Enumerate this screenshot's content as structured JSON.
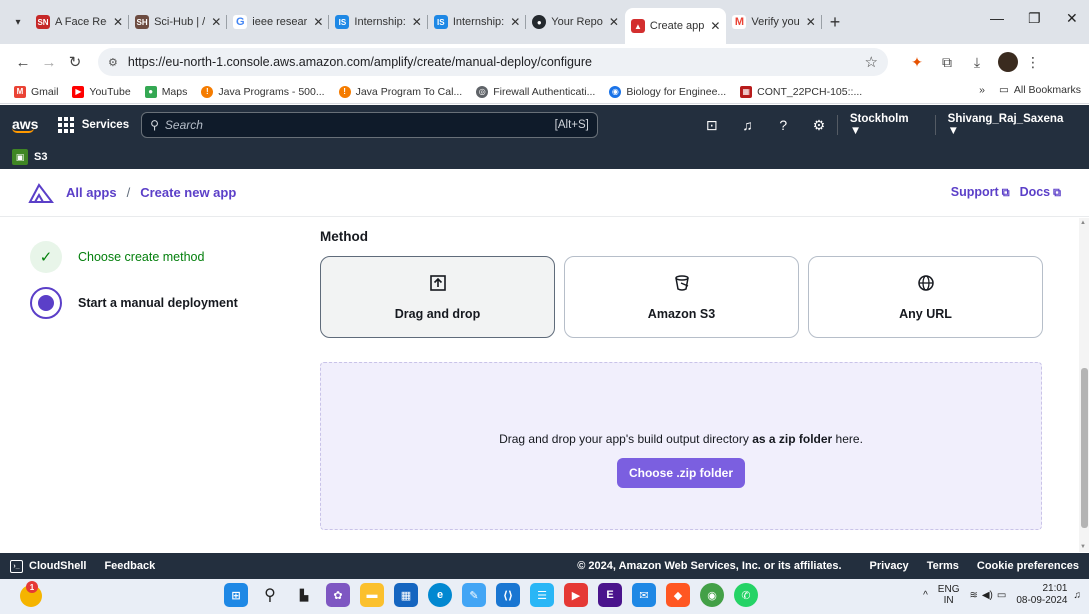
{
  "browser": {
    "tabs": [
      {
        "icon": "sn-icon",
        "color": "#c62828",
        "title": "A Face Rec"
      },
      {
        "icon": "scihub-icon",
        "color": "#6d4c41",
        "title": "Sci-Hub | /"
      },
      {
        "icon": "google-icon",
        "color": "#4285f4",
        "title": "ieee resear"
      },
      {
        "icon": "internshala-icon",
        "color": "#1e88e5",
        "title": "Internship:"
      },
      {
        "icon": "internshala-icon",
        "color": "#1e88e5",
        "title": "Internship:"
      },
      {
        "icon": "github-icon",
        "color": "#24292e",
        "title": "Your Repo"
      },
      {
        "icon": "amplify-icon",
        "color": "#d32f2f",
        "title": "Create app",
        "active": true
      },
      {
        "icon": "gmail-icon",
        "color": "#ea4335",
        "title": "Verify you"
      }
    ],
    "url": "https://eu-north-1.console.aws.amazon.com/amplify/create/manual-deploy/configure",
    "bookmarks": [
      {
        "icon": "gmail-icon",
        "color": "#ea4335",
        "label": "Gmail"
      },
      {
        "icon": "youtube-icon",
        "color": "#ff0000",
        "label": "YouTube"
      },
      {
        "icon": "maps-icon",
        "color": "#34a853",
        "label": "Maps"
      },
      {
        "icon": "java-icon",
        "color": "#f57c00",
        "label": "Java Programs - 500..."
      },
      {
        "icon": "java-icon",
        "color": "#f57c00",
        "label": "Java Program To Cal..."
      },
      {
        "icon": "firewall-icon",
        "color": "#5f6368",
        "label": "Firewall Authenticati..."
      },
      {
        "icon": "biology-icon",
        "color": "#1a73e8",
        "label": "Biology for Enginee..."
      },
      {
        "icon": "cont-icon",
        "color": "#b71c1c",
        "label": "CONT_22PCH-105::..."
      }
    ],
    "all_bookmarks": "All Bookmarks"
  },
  "aws": {
    "services_label": "Services",
    "search_placeholder": "Search",
    "search_shortcut": "[Alt+S]",
    "region": "Stockholm ▼",
    "account": "Shivang_Raj_Saxena ▼",
    "pinned_service": "S3"
  },
  "amplify": {
    "breadcrumb_root": "All apps",
    "breadcrumb_sep": "/",
    "breadcrumb_current": "Create new app",
    "support": "Support",
    "docs": "Docs",
    "steps": [
      {
        "label": "Choose create method",
        "state": "done"
      },
      {
        "label": "Start a manual deployment",
        "state": "current"
      }
    ],
    "method_title": "Method",
    "methods": [
      {
        "label": "Drag and drop",
        "icon": "upload-icon",
        "selected": true
      },
      {
        "label": "Amazon S3",
        "icon": "bucket-icon",
        "selected": false
      },
      {
        "label": "Any URL",
        "icon": "globe-icon",
        "selected": false
      }
    ],
    "dropzone_text_pre": "Drag and drop your app's build output directory ",
    "dropzone_text_bold": "as a zip folder",
    "dropzone_text_post": " here.",
    "choose_button": "Choose .zip folder"
  },
  "footer": {
    "cloudshell": "CloudShell",
    "feedback": "Feedback",
    "copyright": "© 2024, Amazon Web Services, Inc. or its affiliates.",
    "privacy": "Privacy",
    "terms": "Terms",
    "cookies": "Cookie preferences"
  },
  "taskbar": {
    "weather_badge": "1",
    "lang_top": "ENG",
    "lang_bottom": "IN",
    "time": "21:01",
    "date": "08-09-2024"
  },
  "colors": {
    "aws_nav": "#232f3e",
    "amplify_purple": "#5b3fc8",
    "button_purple": "#7b5fe0",
    "dropzone_bg": "#f1effc",
    "success_green": "#037f0c"
  }
}
